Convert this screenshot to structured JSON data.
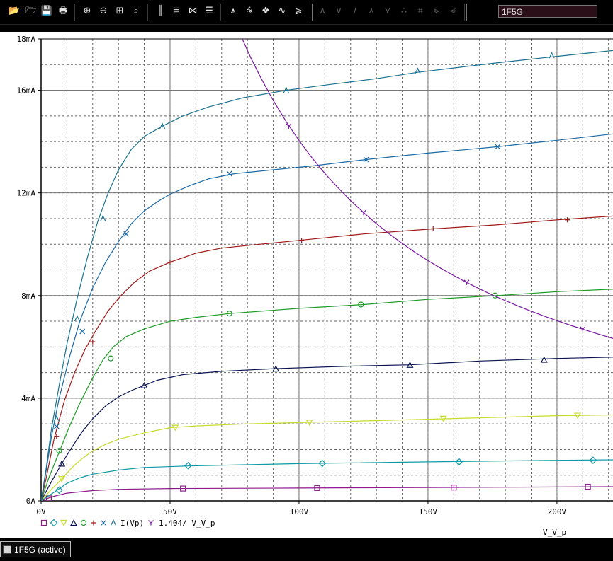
{
  "toolbar": {
    "groups": [
      {
        "name": "file",
        "icons": [
          "open-icon",
          "open-folder-icon",
          "save-icon",
          "print-icon"
        ]
      },
      {
        "name": "zoom",
        "icons": [
          "zoom-in-icon",
          "zoom-out-icon",
          "zoom-area-icon",
          "zoom-fit-icon"
        ]
      },
      {
        "name": "axes",
        "icons": [
          "log-x-icon",
          "fourier-icon",
          "performance-icon",
          "log-y-icon"
        ]
      },
      {
        "name": "trace",
        "icons": [
          "add-trace-icon",
          "eval-goal-icon",
          "color-legend-icon",
          "cursor-icon",
          "mark-label-icon"
        ]
      },
      {
        "name": "cursor",
        "icons": [
          "peak-icon",
          "trough-icon",
          "slope-icon",
          "min-icon",
          "max-icon",
          "point-icon",
          "search-icon",
          "next-transition-icon",
          "previous-transition-icon"
        ]
      }
    ],
    "trace_select": "1F5G"
  },
  "statusbar": {
    "tab_label": "1F5G (active)"
  },
  "colors": {
    "background": "#ffffff",
    "frame": "#000000",
    "series": [
      "#8b1c8b",
      "#0f9aa6",
      "#c6dc2a",
      "#0a1450",
      "#1d9b25",
      "#a01818",
      "#1a6aa6",
      "#1a7290",
      "#7a1aa0"
    ]
  },
  "chart_data": {
    "type": "line",
    "title": "",
    "xlabel": "V_V_p",
    "ylabel": "",
    "xlim": [
      0,
      222
    ],
    "ylim": [
      0,
      18
    ],
    "xticks": [
      0,
      50,
      100,
      150,
      200
    ],
    "xtick_labels": [
      "0V",
      "50V",
      "100V",
      "150V",
      "200V"
    ],
    "yticks": [
      0,
      4,
      8,
      12,
      16,
      18
    ],
    "ytick_labels": [
      "0A",
      "4mA",
      "8mA",
      "12mA",
      "16mA",
      "18mA"
    ],
    "x_minor_step": 10,
    "y_minor_step": 1,
    "grid": true,
    "legend_position": "bottom-left",
    "legend_text": "I(Vp)",
    "legend_text2": "1.404/ V_V_p",
    "series": [
      {
        "marker": "square",
        "color": "#8b1c8b",
        "points": [
          [
            0,
            0
          ],
          [
            2,
            0.08
          ],
          [
            5,
            0.18
          ],
          [
            10,
            0.3
          ],
          [
            20,
            0.4
          ],
          [
            30,
            0.45
          ],
          [
            50,
            0.48
          ],
          [
            100,
            0.5
          ],
          [
            150,
            0.52
          ],
          [
            200,
            0.54
          ],
          [
            222,
            0.55
          ]
        ],
        "markers": [
          [
            3,
            0.1
          ],
          [
            55,
            0.48
          ],
          [
            107,
            0.5
          ],
          [
            160,
            0.52
          ],
          [
            212,
            0.55
          ]
        ]
      },
      {
        "marker": "diamond",
        "color": "#0f9aa6",
        "points": [
          [
            0,
            0
          ],
          [
            3,
            0.2
          ],
          [
            6,
            0.4
          ],
          [
            10,
            0.68
          ],
          [
            15,
            0.9
          ],
          [
            20,
            1.04
          ],
          [
            30,
            1.2
          ],
          [
            40,
            1.3
          ],
          [
            57,
            1.36
          ],
          [
            100,
            1.45
          ],
          [
            150,
            1.52
          ],
          [
            200,
            1.58
          ],
          [
            222,
            1.6
          ]
        ],
        "markers": [
          [
            7,
            0.42
          ],
          [
            57,
            1.37
          ],
          [
            109,
            1.46
          ],
          [
            162,
            1.52
          ],
          [
            214,
            1.58
          ]
        ]
      },
      {
        "marker": "triangle-down",
        "color": "#c6dc2a",
        "points": [
          [
            0,
            0
          ],
          [
            4,
            0.45
          ],
          [
            8,
            0.85
          ],
          [
            12,
            1.3
          ],
          [
            16,
            1.65
          ],
          [
            20,
            1.95
          ],
          [
            25,
            2.2
          ],
          [
            30,
            2.4
          ],
          [
            40,
            2.65
          ],
          [
            50,
            2.85
          ],
          [
            60,
            2.92
          ],
          [
            80,
            3.0
          ],
          [
            100,
            3.05
          ],
          [
            150,
            3.18
          ],
          [
            200,
            3.32
          ],
          [
            222,
            3.35
          ]
        ],
        "markers": [
          [
            8,
            0.85
          ],
          [
            52,
            2.85
          ],
          [
            104,
            3.05
          ],
          [
            156,
            3.2
          ],
          [
            208,
            3.32
          ]
        ]
      },
      {
        "marker": "triangle",
        "color": "#0a1450",
        "points": [
          [
            0,
            0
          ],
          [
            4,
            0.75
          ],
          [
            8,
            1.45
          ],
          [
            12,
            2.1
          ],
          [
            16,
            2.7
          ],
          [
            20,
            3.2
          ],
          [
            25,
            3.7
          ],
          [
            30,
            4.05
          ],
          [
            35,
            4.3
          ],
          [
            40,
            4.5
          ],
          [
            45,
            4.7
          ],
          [
            55,
            4.92
          ],
          [
            70,
            5.05
          ],
          [
            90,
            5.15
          ],
          [
            120,
            5.25
          ],
          [
            143,
            5.3
          ],
          [
            170,
            5.45
          ],
          [
            200,
            5.55
          ],
          [
            222,
            5.6
          ]
        ],
        "markers": [
          [
            8,
            1.45
          ],
          [
            40,
            4.5
          ],
          [
            91,
            5.15
          ],
          [
            143,
            5.3
          ],
          [
            195,
            5.5
          ]
        ]
      },
      {
        "marker": "circle",
        "color": "#1d9b25",
        "points": [
          [
            0,
            0
          ],
          [
            3,
            0.9
          ],
          [
            7,
            1.9
          ],
          [
            11,
            2.9
          ],
          [
            15,
            3.8
          ],
          [
            20,
            4.8
          ],
          [
            24,
            5.5
          ],
          [
            28,
            6.0
          ],
          [
            33,
            6.4
          ],
          [
            40,
            6.7
          ],
          [
            50,
            7.0
          ],
          [
            60,
            7.15
          ],
          [
            73,
            7.3
          ],
          [
            100,
            7.5
          ],
          [
            125,
            7.65
          ],
          [
            150,
            7.85
          ],
          [
            177,
            8.0
          ],
          [
            200,
            8.15
          ],
          [
            222,
            8.25
          ]
        ],
        "markers": [
          [
            7,
            1.95
          ],
          [
            27,
            5.55
          ],
          [
            73,
            7.3
          ],
          [
            124,
            7.65
          ],
          [
            176,
            8.0
          ]
        ]
      },
      {
        "marker": "plus",
        "color": "#a01818",
        "points": [
          [
            0,
            0
          ],
          [
            2,
            0.9
          ],
          [
            5,
            2.4
          ],
          [
            9,
            3.9
          ],
          [
            13,
            5.0
          ],
          [
            17,
            5.9
          ],
          [
            21,
            6.6
          ],
          [
            26,
            7.4
          ],
          [
            31,
            8.0
          ],
          [
            36,
            8.5
          ],
          [
            42,
            8.95
          ],
          [
            50,
            9.3
          ],
          [
            60,
            9.65
          ],
          [
            70,
            9.85
          ],
          [
            85,
            10.0
          ],
          [
            100,
            10.15
          ],
          [
            125,
            10.4
          ],
          [
            152,
            10.6
          ],
          [
            176,
            10.75
          ],
          [
            200,
            10.95
          ],
          [
            222,
            11.1
          ]
        ],
        "markers": [
          [
            6,
            2.5
          ],
          [
            20,
            6.2
          ],
          [
            50,
            9.3
          ],
          [
            101,
            10.15
          ],
          [
            152,
            10.6
          ],
          [
            204,
            10.95
          ]
        ]
      },
      {
        "marker": "x",
        "color": "#1a6aa6",
        "points": [
          [
            0,
            0
          ],
          [
            2,
            1.2
          ],
          [
            4,
            2.5
          ],
          [
            7,
            4.0
          ],
          [
            11,
            5.6
          ],
          [
            15,
            7.0
          ],
          [
            20,
            8.3
          ],
          [
            25,
            9.3
          ],
          [
            30,
            10.1
          ],
          [
            35,
            10.8
          ],
          [
            40,
            11.3
          ],
          [
            45,
            11.65
          ],
          [
            50,
            11.95
          ],
          [
            58,
            12.3
          ],
          [
            65,
            12.55
          ],
          [
            75,
            12.75
          ],
          [
            90,
            12.9
          ],
          [
            105,
            13.05
          ],
          [
            126,
            13.3
          ],
          [
            150,
            13.55
          ],
          [
            177,
            13.8
          ],
          [
            200,
            14.05
          ],
          [
            222,
            14.3
          ]
        ],
        "markers": [
          [
            6,
            2.9
          ],
          [
            16,
            6.6
          ],
          [
            33,
            10.4
          ],
          [
            73,
            12.75
          ],
          [
            126,
            13.3
          ],
          [
            177,
            13.8
          ]
        ]
      },
      {
        "marker": "lambda",
        "color": "#1a7290",
        "points": [
          [
            0,
            0
          ],
          [
            2,
            1.3
          ],
          [
            4,
            2.8
          ],
          [
            7,
            4.5
          ],
          [
            10,
            6.1
          ],
          [
            14,
            7.9
          ],
          [
            18,
            9.5
          ],
          [
            22,
            10.9
          ],
          [
            26,
            12.0
          ],
          [
            30,
            12.9
          ],
          [
            35,
            13.7
          ],
          [
            40,
            14.2
          ],
          [
            47,
            14.6
          ],
          [
            55,
            15.0
          ],
          [
            65,
            15.35
          ],
          [
            78,
            15.7
          ],
          [
            95,
            16.0
          ],
          [
            110,
            16.2
          ],
          [
            130,
            16.45
          ],
          [
            146,
            16.7
          ],
          [
            175,
            17.05
          ],
          [
            198,
            17.3
          ],
          [
            222,
            17.55
          ]
        ],
        "markers": [
          [
            6,
            3.2
          ],
          [
            14,
            7.1
          ],
          [
            24,
            11.0
          ],
          [
            47,
            14.6
          ],
          [
            95,
            16.0
          ],
          [
            146,
            16.75
          ],
          [
            198,
            17.35
          ]
        ]
      },
      {
        "marker": "y",
        "color": "#7a1aa0",
        "points": [
          [
            78,
            18
          ],
          [
            81,
            17.33
          ],
          [
            85,
            16.52
          ],
          [
            90,
            15.6
          ],
          [
            95,
            14.78
          ],
          [
            100,
            14.04
          ],
          [
            105,
            13.37
          ],
          [
            110,
            12.76
          ],
          [
            115,
            12.21
          ],
          [
            120,
            11.7
          ],
          [
            125,
            11.23
          ],
          [
            130,
            10.8
          ],
          [
            135,
            10.4
          ],
          [
            140,
            10.03
          ],
          [
            145,
            9.68
          ],
          [
            150,
            9.36
          ],
          [
            155,
            9.06
          ],
          [
            160,
            8.78
          ],
          [
            165,
            8.51
          ],
          [
            170,
            8.26
          ],
          [
            175,
            8.02
          ],
          [
            180,
            7.8
          ],
          [
            185,
            7.59
          ],
          [
            190,
            7.39
          ],
          [
            195,
            7.2
          ],
          [
            200,
            7.02
          ],
          [
            205,
            6.85
          ],
          [
            210,
            6.69
          ],
          [
            215,
            6.53
          ],
          [
            222,
            6.32
          ]
        ],
        "markers": [
          [
            96,
            14.6
          ],
          [
            125,
            11.23
          ],
          [
            165,
            8.51
          ],
          [
            210,
            6.69
          ]
        ]
      }
    ]
  }
}
